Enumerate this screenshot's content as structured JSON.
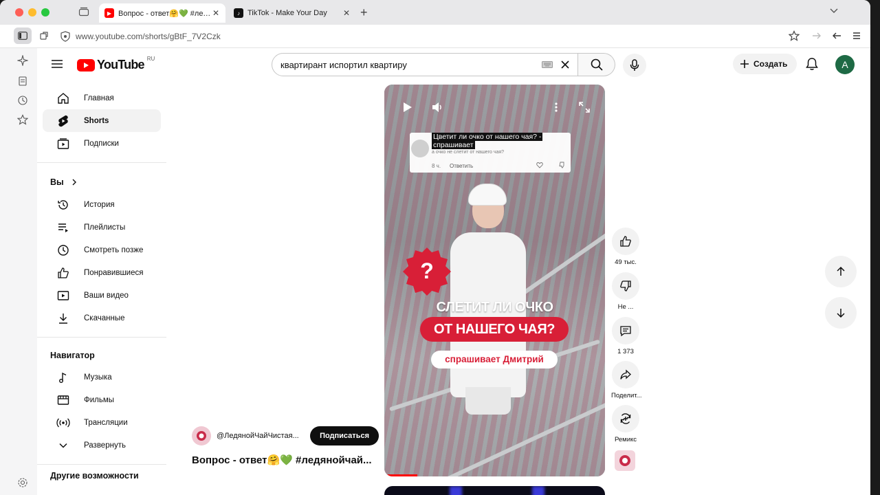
{
  "browser": {
    "tabs": [
      {
        "title": "Вопрос - ответ🤗💚 #ледянойч",
        "active": true,
        "favicon": "youtube-icon"
      },
      {
        "title": "TikTok - Make Your Day",
        "active": false,
        "favicon": "tiktok-icon"
      }
    ],
    "url": "www.youtube.com/shorts/gBtF_7V2Czk"
  },
  "youtube": {
    "logo_text": "YouTube",
    "region": "RU",
    "search_query": "квартирант испортил квартиру",
    "create_label": "Создать",
    "avatar_letter": "A"
  },
  "nav": {
    "main": [
      {
        "label": "Главная",
        "icon": "home-icon"
      },
      {
        "label": "Shorts",
        "icon": "shorts-icon"
      },
      {
        "label": "Подписки",
        "icon": "subscriptions-icon"
      }
    ],
    "you_heading": "Вы",
    "you_items": [
      {
        "label": "История",
        "icon": "history-icon"
      },
      {
        "label": "Плейлисты",
        "icon": "playlists-icon"
      },
      {
        "label": "Смотреть позже",
        "icon": "watch-later-icon"
      },
      {
        "label": "Понравившиеся",
        "icon": "liked-icon"
      },
      {
        "label": "Ваши видео",
        "icon": "your-videos-icon"
      },
      {
        "label": "Скачанные",
        "icon": "downloads-icon"
      }
    ],
    "navigator_heading": "Навигатор",
    "navigator_items": [
      {
        "label": "Музыка",
        "icon": "music-icon"
      },
      {
        "label": "Фильмы",
        "icon": "movies-icon"
      },
      {
        "label": "Трансляции",
        "icon": "live-icon"
      },
      {
        "label": "Развернуть",
        "icon": "chevron-down-icon"
      }
    ],
    "more_heading": "Другие возможности"
  },
  "short": {
    "comment_line1": "Цветит ли очко от нашего чая? -",
    "comment_line2": "спрашивает",
    "comment_sub": "а очко не слетит от нашего чая?",
    "comment_time": "8 ч.",
    "comment_reply": "Ответить",
    "caption1": "СЛЕТИТ ЛИ ОЧКО",
    "caption2": "ОТ НАШЕГО ЧАЯ?",
    "caption3": "спрашивает Дмитрий",
    "channel": "@ЛедянойЧайЧистая...",
    "subscribe_label": "Подписаться",
    "title": "Вопрос - ответ🤗💚 #ледянойчай...",
    "progress": 0.15
  },
  "actions": {
    "likes": "49 тыс.",
    "dislike": "Не ...",
    "comments": "1 373",
    "share": "Поделит...",
    "remix": "Ремикс"
  },
  "colors": {
    "yt_red": "#ff0000",
    "caption_red": "#d81f37",
    "avatar_green": "#1e6a45"
  }
}
